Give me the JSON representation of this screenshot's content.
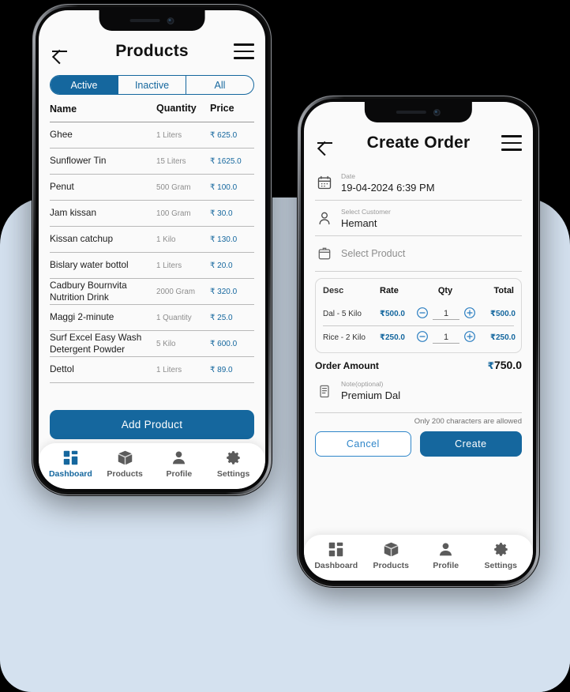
{
  "theme": {
    "accent": "#15679e",
    "accent_light": "#2f86c9",
    "backdrop": "#d4e1ef",
    "canvas": "#000000",
    "muted_text": "#8d8d8d"
  },
  "phone_products": {
    "appbar": {
      "back_icon": "arrow-left-icon",
      "title": "Products",
      "menu_icon": "hamburger-menu-icon"
    },
    "segmented": {
      "options": [
        "Active",
        "Inactive",
        "All"
      ],
      "selected": "Active"
    },
    "table": {
      "columns": [
        "Name",
        "Quantity",
        "Price"
      ],
      "rows": [
        {
          "name": "Ghee",
          "quantity": "1 Liters",
          "price": "625.0"
        },
        {
          "name": "Sunflower Tin",
          "quantity": "15 Liters",
          "price": "1625.0"
        },
        {
          "name": "Penut",
          "quantity": "500 Gram",
          "price": "100.0"
        },
        {
          "name": "Jam kissan",
          "quantity": "100 Gram",
          "price": "30.0"
        },
        {
          "name": "Kissan catchup",
          "quantity": "1 Kilo",
          "price": "130.0"
        },
        {
          "name": "Bislary water bottol",
          "quantity": "1 Liters",
          "price": "20.0"
        },
        {
          "name": "Cadbury Bournvita Nutrition Drink",
          "quantity": "2000 Gram",
          "price": "320.0"
        },
        {
          "name": "Maggi 2-minute",
          "quantity": "1 Quantity",
          "price": "25.0"
        },
        {
          "name": "Surf Excel Easy Wash Detergent Powder",
          "quantity": "5 Kilo",
          "price": "600.0"
        },
        {
          "name": "Dettol",
          "quantity": "1 Liters",
          "price": "89.0"
        }
      ]
    },
    "add_product_label": "Add Product",
    "bottom_nav": {
      "items": [
        {
          "label": "Dashboard",
          "icon": "dashboard-grid-icon",
          "active": true
        },
        {
          "label": "Products",
          "icon": "box-icon",
          "active": false
        },
        {
          "label": "Profile",
          "icon": "person-icon",
          "active": false
        },
        {
          "label": "Settings",
          "icon": "gear-icon",
          "active": false
        }
      ]
    }
  },
  "phone_create_order": {
    "appbar": {
      "back_icon": "arrow-left-icon",
      "title": "Create Order",
      "menu_icon": "hamburger-menu-icon"
    },
    "fields": {
      "date": {
        "icon": "calendar-icon",
        "label": "Date",
        "value": "19-04-2024 6:39 PM"
      },
      "customer": {
        "icon": "person-outline-icon",
        "label": "Select Customer",
        "value": "Hemant"
      },
      "product": {
        "icon": "product-box-outline-icon",
        "placeholder": "Select Product"
      },
      "note": {
        "icon": "note-clipboard-icon",
        "label": "Note(optional)",
        "value": "Premium Dal"
      }
    },
    "items_table": {
      "columns": [
        "Desc",
        "Rate",
        "Qty",
        "Total"
      ],
      "rows": [
        {
          "desc": "Dal - 5 Kilo",
          "rate": "500.0",
          "qty": "1",
          "total": "500.0",
          "minus_icon": "circle-minus-icon",
          "plus_icon": "circle-plus-icon"
        },
        {
          "desc": "Rice - 2 Kilo",
          "rate": "250.0",
          "qty": "1",
          "total": "250.0",
          "minus_icon": "circle-minus-icon",
          "plus_icon": "circle-plus-icon"
        }
      ]
    },
    "order_amount": {
      "label": "Order Amount",
      "value": "750.0"
    },
    "char_limit_hint": "Only 200 characters are allowed",
    "buttons": {
      "cancel": "Cancel",
      "create": "Create"
    },
    "bottom_nav": {
      "items": [
        {
          "label": "Dashboard",
          "icon": "dashboard-grid-icon",
          "active": false
        },
        {
          "label": "Products",
          "icon": "box-icon",
          "active": false
        },
        {
          "label": "Profile",
          "icon": "person-icon",
          "active": false
        },
        {
          "label": "Settings",
          "icon": "gear-icon",
          "active": false
        }
      ]
    }
  },
  "currency_symbol": "₹"
}
